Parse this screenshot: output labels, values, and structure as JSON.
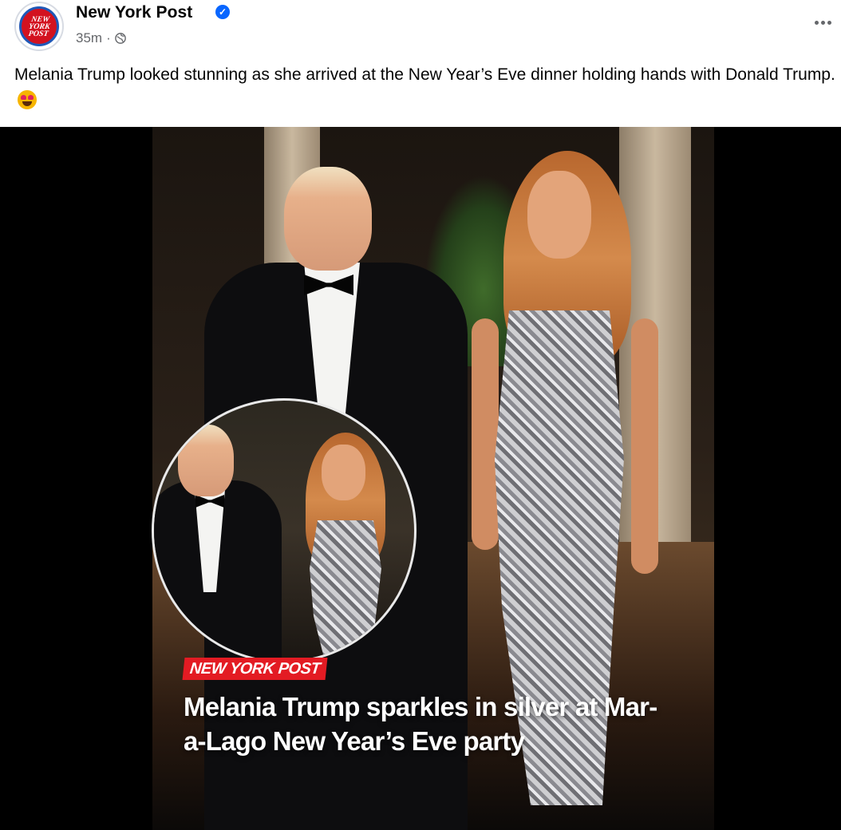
{
  "post": {
    "page_name": "New York Post",
    "verified": true,
    "timestamp": "35m",
    "separator": "·",
    "audience_icon": "globe-icon",
    "more_icon": "more-options-icon",
    "caption": "Melania Trump looked stunning as she arrived at the New Year’s Eve dinner holding hands with Donald Trump.",
    "caption_emoji": "heart-eyes-emoji",
    "avatar_logo_text": "NEW\nYORK\nPOST"
  },
  "media": {
    "badge": "NEW YORK POST",
    "headline": "Melania Trump sparkles in silver at Mar-a-Lago New Year’s Eve party"
  },
  "colors": {
    "brand_red": "#e31b23",
    "verified_blue": "#0866ff",
    "meta_gray": "#65676b"
  }
}
